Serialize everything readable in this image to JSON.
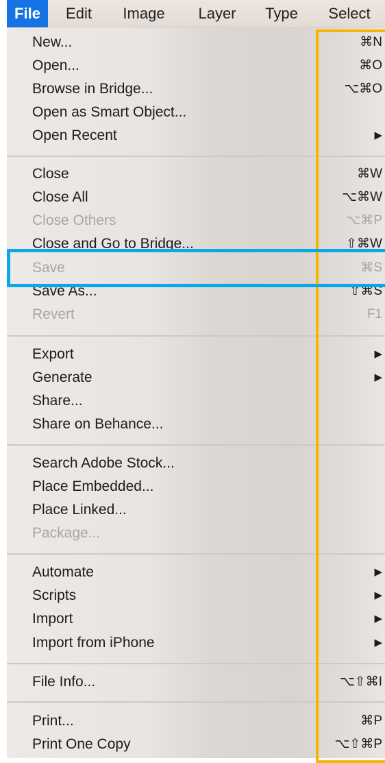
{
  "menubar": {
    "items": [
      {
        "label": "File",
        "active": true
      },
      {
        "label": "Edit"
      },
      {
        "label": "Image"
      },
      {
        "label": "Layer"
      },
      {
        "label": "Type"
      },
      {
        "label": "Select"
      }
    ]
  },
  "menu": {
    "items": [
      {
        "label": "New...",
        "shortcut": "⌘N",
        "enabled": true
      },
      {
        "label": "Open...",
        "shortcut": "⌘O",
        "enabled": true
      },
      {
        "label": "Browse in Bridge...",
        "shortcut": "⌥⌘O",
        "enabled": true
      },
      {
        "label": "Open as Smart Object...",
        "shortcut": "",
        "enabled": true
      },
      {
        "label": "Open Recent",
        "shortcut": "▶",
        "enabled": true,
        "submenu": true
      },
      {
        "label": "Close",
        "shortcut": "⌘W",
        "enabled": true
      },
      {
        "label": "Close All",
        "shortcut": "⌥⌘W",
        "enabled": true
      },
      {
        "label": "Close Others",
        "shortcut": "⌥⌘P",
        "enabled": false
      },
      {
        "label": "Close and Go to Bridge...",
        "shortcut": "⇧⌘W",
        "enabled": true
      },
      {
        "label": "Save",
        "shortcut": "⌘S",
        "enabled": false
      },
      {
        "label": "Save As...",
        "shortcut": "⇧⌘S",
        "enabled": true
      },
      {
        "label": "Revert",
        "shortcut": "F1",
        "enabled": false
      },
      {
        "label": "Export",
        "shortcut": "▶",
        "enabled": true,
        "submenu": true
      },
      {
        "label": "Generate",
        "shortcut": "▶",
        "enabled": true,
        "submenu": true
      },
      {
        "label": "Share...",
        "shortcut": "",
        "enabled": true
      },
      {
        "label": "Share on Behance...",
        "shortcut": "",
        "enabled": true
      },
      {
        "label": "Search Adobe Stock...",
        "shortcut": "",
        "enabled": true
      },
      {
        "label": "Place Embedded...",
        "shortcut": "",
        "enabled": true
      },
      {
        "label": "Place Linked...",
        "shortcut": "",
        "enabled": true
      },
      {
        "label": "Package...",
        "shortcut": "",
        "enabled": false
      },
      {
        "label": "Automate",
        "shortcut": "▶",
        "enabled": true,
        "submenu": true
      },
      {
        "label": "Scripts",
        "shortcut": "▶",
        "enabled": true,
        "submenu": true
      },
      {
        "label": "Import",
        "shortcut": "▶",
        "enabled": true,
        "submenu": true
      },
      {
        "label": "Import from iPhone",
        "shortcut": "▶",
        "enabled": true,
        "submenu": true
      },
      {
        "label": "File Info...",
        "shortcut": "⌥⇧⌘I",
        "enabled": true
      },
      {
        "label": "Print...",
        "shortcut": "⌘P",
        "enabled": true
      },
      {
        "label": "Print One Copy",
        "shortcut": "⌥⇧⌘P",
        "enabled": true
      }
    ]
  },
  "annotations": {
    "orange_box_color": "#f7b500",
    "blue_box_color": "#0aa8e8"
  }
}
